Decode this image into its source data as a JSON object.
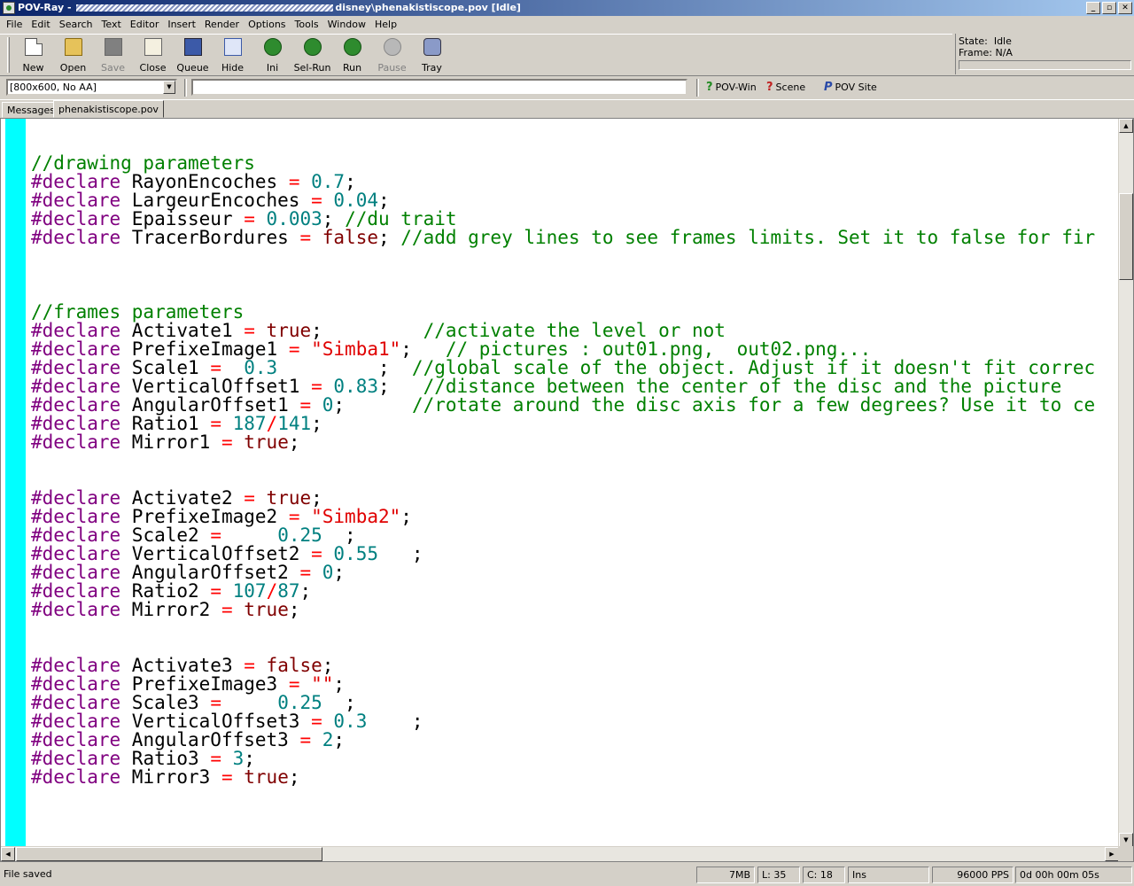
{
  "window": {
    "title_prefix": "POV-Ray - ",
    "title_path_end": "disney\\phenakistiscope.pov [Idle]",
    "controls": [
      "_",
      "▫",
      "✕"
    ]
  },
  "menu": [
    "File",
    "Edit",
    "Search",
    "Text",
    "Editor",
    "Insert",
    "Render",
    "Options",
    "Tools",
    "Window",
    "Help"
  ],
  "toolbar": [
    {
      "label": "New",
      "icon": "new-file-icon",
      "enabled": true
    },
    {
      "label": "Open",
      "icon": "open-folder-icon",
      "enabled": true
    },
    {
      "label": "Save",
      "icon": "save-icon",
      "enabled": false
    },
    {
      "label": "Close",
      "icon": "close-file-icon",
      "enabled": true
    },
    {
      "label": "Queue",
      "icon": "queue-icon",
      "enabled": true
    },
    {
      "label": "Hide",
      "icon": "hide-icon",
      "enabled": true
    },
    {
      "label": "Ini",
      "icon": "ini-icon",
      "enabled": true
    },
    {
      "label": "Sel-Run",
      "icon": "sel-run-icon",
      "enabled": true
    },
    {
      "label": "Run",
      "icon": "run-icon",
      "enabled": true
    },
    {
      "label": "Pause",
      "icon": "pause-icon",
      "enabled": false
    },
    {
      "label": "Tray",
      "icon": "tray-icon",
      "enabled": true
    }
  ],
  "render_status": {
    "state_label": "State:",
    "state_value": "Idle",
    "frame_label": "Frame:",
    "frame_value": "N/A"
  },
  "address": {
    "resolution": "[800x600, No AA]",
    "command": "",
    "links": [
      "POV-Win",
      "Scene",
      "POV Site"
    ]
  },
  "tabs": [
    "Messages",
    "phenakistiscope.pov"
  ],
  "code_lines": [
    [],
    [
      [
        "comment",
        "//drawing parameters"
      ]
    ],
    [
      [
        "directive",
        "#declare"
      ],
      [
        "ident",
        " RayonEncoches "
      ],
      [
        "op",
        "="
      ],
      [
        "ident",
        " "
      ],
      [
        "num",
        "0.7"
      ],
      [
        "ident",
        ";"
      ]
    ],
    [
      [
        "directive",
        "#declare"
      ],
      [
        "ident",
        " LargeurEncoches "
      ],
      [
        "op",
        "="
      ],
      [
        "ident",
        " "
      ],
      [
        "num",
        "0.04"
      ],
      [
        "ident",
        ";"
      ]
    ],
    [
      [
        "directive",
        "#declare"
      ],
      [
        "ident",
        " Epaisseur "
      ],
      [
        "op",
        "="
      ],
      [
        "ident",
        " "
      ],
      [
        "num",
        "0.003"
      ],
      [
        "ident",
        "; "
      ],
      [
        "comment",
        "//du trait"
      ]
    ],
    [
      [
        "directive",
        "#declare"
      ],
      [
        "ident",
        " TracerBordures "
      ],
      [
        "op",
        "="
      ],
      [
        "ident",
        " "
      ],
      [
        "bool",
        "false"
      ],
      [
        "ident",
        "; "
      ],
      [
        "comment",
        "//add grey lines to see frames limits. Set it to false for fir"
      ]
    ],
    [],
    [],
    [],
    [
      [
        "comment",
        "//frames parameters"
      ]
    ],
    [
      [
        "directive",
        "#declare"
      ],
      [
        "ident",
        " Activate1 "
      ],
      [
        "op",
        "="
      ],
      [
        "ident",
        " "
      ],
      [
        "bool",
        "true"
      ],
      [
        "ident",
        ";         "
      ],
      [
        "comment",
        "//activate the level or not"
      ]
    ],
    [
      [
        "directive",
        "#declare"
      ],
      [
        "ident",
        " PrefixeImage1 "
      ],
      [
        "op",
        "="
      ],
      [
        "ident",
        " "
      ],
      [
        "str",
        "\"Simba1\""
      ],
      [
        "ident",
        ";   "
      ],
      [
        "comment",
        "// pictures : out01.png,  out02.png..."
      ]
    ],
    [
      [
        "directive",
        "#declare"
      ],
      [
        "ident",
        " Scale1 "
      ],
      [
        "op",
        "="
      ],
      [
        "ident",
        "  "
      ],
      [
        "num",
        "0.3"
      ],
      [
        "ident",
        "         ;  "
      ],
      [
        "comment",
        "//global scale of the object. Adjust if it doesn't fit correc"
      ]
    ],
    [
      [
        "directive",
        "#declare"
      ],
      [
        "ident",
        " VerticalOffset1 "
      ],
      [
        "op",
        "="
      ],
      [
        "ident",
        " "
      ],
      [
        "num",
        "0.83"
      ],
      [
        "ident",
        ";   "
      ],
      [
        "comment",
        "//distance between the center of the disc and the picture"
      ]
    ],
    [
      [
        "directive",
        "#declare"
      ],
      [
        "ident",
        " AngularOffset1 "
      ],
      [
        "op",
        "="
      ],
      [
        "ident",
        " "
      ],
      [
        "num",
        "0"
      ],
      [
        "ident",
        ";      "
      ],
      [
        "comment",
        "//rotate around the disc axis for a few degrees? Use it to ce"
      ]
    ],
    [
      [
        "directive",
        "#declare"
      ],
      [
        "ident",
        " Ratio1 "
      ],
      [
        "op",
        "="
      ],
      [
        "ident",
        " "
      ],
      [
        "num",
        "187"
      ],
      [
        "op",
        "/"
      ],
      [
        "num",
        "141"
      ],
      [
        "ident",
        ";"
      ]
    ],
    [
      [
        "directive",
        "#declare"
      ],
      [
        "ident",
        " Mirror1 "
      ],
      [
        "op",
        "="
      ],
      [
        "ident",
        " "
      ],
      [
        "bool",
        "true"
      ],
      [
        "ident",
        ";"
      ]
    ],
    [],
    [],
    [
      [
        "directive",
        "#declare"
      ],
      [
        "ident",
        " Activate2 "
      ],
      [
        "op",
        "="
      ],
      [
        "ident",
        " "
      ],
      [
        "bool",
        "true"
      ],
      [
        "ident",
        ";"
      ]
    ],
    [
      [
        "directive",
        "#declare"
      ],
      [
        "ident",
        " PrefixeImage2 "
      ],
      [
        "op",
        "="
      ],
      [
        "ident",
        " "
      ],
      [
        "str",
        "\"Simba2\""
      ],
      [
        "ident",
        ";"
      ]
    ],
    [
      [
        "directive",
        "#declare"
      ],
      [
        "ident",
        " Scale2 "
      ],
      [
        "op",
        "="
      ],
      [
        "ident",
        "     "
      ],
      [
        "num",
        "0.25"
      ],
      [
        "ident",
        "  ;"
      ]
    ],
    [
      [
        "directive",
        "#declare"
      ],
      [
        "ident",
        " VerticalOffset2 "
      ],
      [
        "op",
        "="
      ],
      [
        "ident",
        " "
      ],
      [
        "num",
        "0.55"
      ],
      [
        "ident",
        "   ;"
      ]
    ],
    [
      [
        "directive",
        "#declare"
      ],
      [
        "ident",
        " AngularOffset2 "
      ],
      [
        "op",
        "="
      ],
      [
        "ident",
        " "
      ],
      [
        "num",
        "0"
      ],
      [
        "ident",
        ";"
      ]
    ],
    [
      [
        "directive",
        "#declare"
      ],
      [
        "ident",
        " Ratio2 "
      ],
      [
        "op",
        "="
      ],
      [
        "ident",
        " "
      ],
      [
        "num",
        "107"
      ],
      [
        "op",
        "/"
      ],
      [
        "num",
        "87"
      ],
      [
        "ident",
        ";"
      ]
    ],
    [
      [
        "directive",
        "#declare"
      ],
      [
        "ident",
        " Mirror2 "
      ],
      [
        "op",
        "="
      ],
      [
        "ident",
        " "
      ],
      [
        "bool",
        "true"
      ],
      [
        "ident",
        ";"
      ]
    ],
    [],
    [],
    [
      [
        "directive",
        "#declare"
      ],
      [
        "ident",
        " Activate3 "
      ],
      [
        "op",
        "="
      ],
      [
        "ident",
        " "
      ],
      [
        "bool",
        "false"
      ],
      [
        "ident",
        ";"
      ]
    ],
    [
      [
        "directive",
        "#declare"
      ],
      [
        "ident",
        " PrefixeImage3 "
      ],
      [
        "op",
        "="
      ],
      [
        "ident",
        " "
      ],
      [
        "str",
        "\"\""
      ],
      [
        "ident",
        ";"
      ]
    ],
    [
      [
        "directive",
        "#declare"
      ],
      [
        "ident",
        " Scale3 "
      ],
      [
        "op",
        "="
      ],
      [
        "ident",
        "     "
      ],
      [
        "num",
        "0.25"
      ],
      [
        "ident",
        "  ;"
      ]
    ],
    [
      [
        "directive",
        "#declare"
      ],
      [
        "ident",
        " VerticalOffset3 "
      ],
      [
        "op",
        "="
      ],
      [
        "ident",
        " "
      ],
      [
        "num",
        "0.3"
      ],
      [
        "ident",
        "    ;"
      ]
    ],
    [
      [
        "directive",
        "#declare"
      ],
      [
        "ident",
        " AngularOffset3 "
      ],
      [
        "op",
        "="
      ],
      [
        "ident",
        " "
      ],
      [
        "num",
        "2"
      ],
      [
        "ident",
        ";"
      ]
    ],
    [
      [
        "directive",
        "#declare"
      ],
      [
        "ident",
        " Ratio3 "
      ],
      [
        "op",
        "="
      ],
      [
        "ident",
        " "
      ],
      [
        "num",
        "3"
      ],
      [
        "ident",
        ";"
      ]
    ],
    [
      [
        "directive",
        "#declare"
      ],
      [
        "ident",
        " Mirror3 "
      ],
      [
        "op",
        "="
      ],
      [
        "ident",
        " "
      ],
      [
        "bool",
        "true"
      ],
      [
        "ident",
        ";"
      ]
    ]
  ],
  "statusbar": {
    "message": "File saved",
    "memory": "7MB",
    "line": "L: 35",
    "column": "C: 18",
    "mode": "Ins",
    "pps": "96000 PPS",
    "elapsed": "0d 00h 00m 05s"
  },
  "colors": {
    "comment": "#008000",
    "directive": "#800080",
    "number": "#008080",
    "operator": "#ff0000",
    "string": "#e00000",
    "keyword_bool": "#800000",
    "gutter": "#00ffff"
  }
}
